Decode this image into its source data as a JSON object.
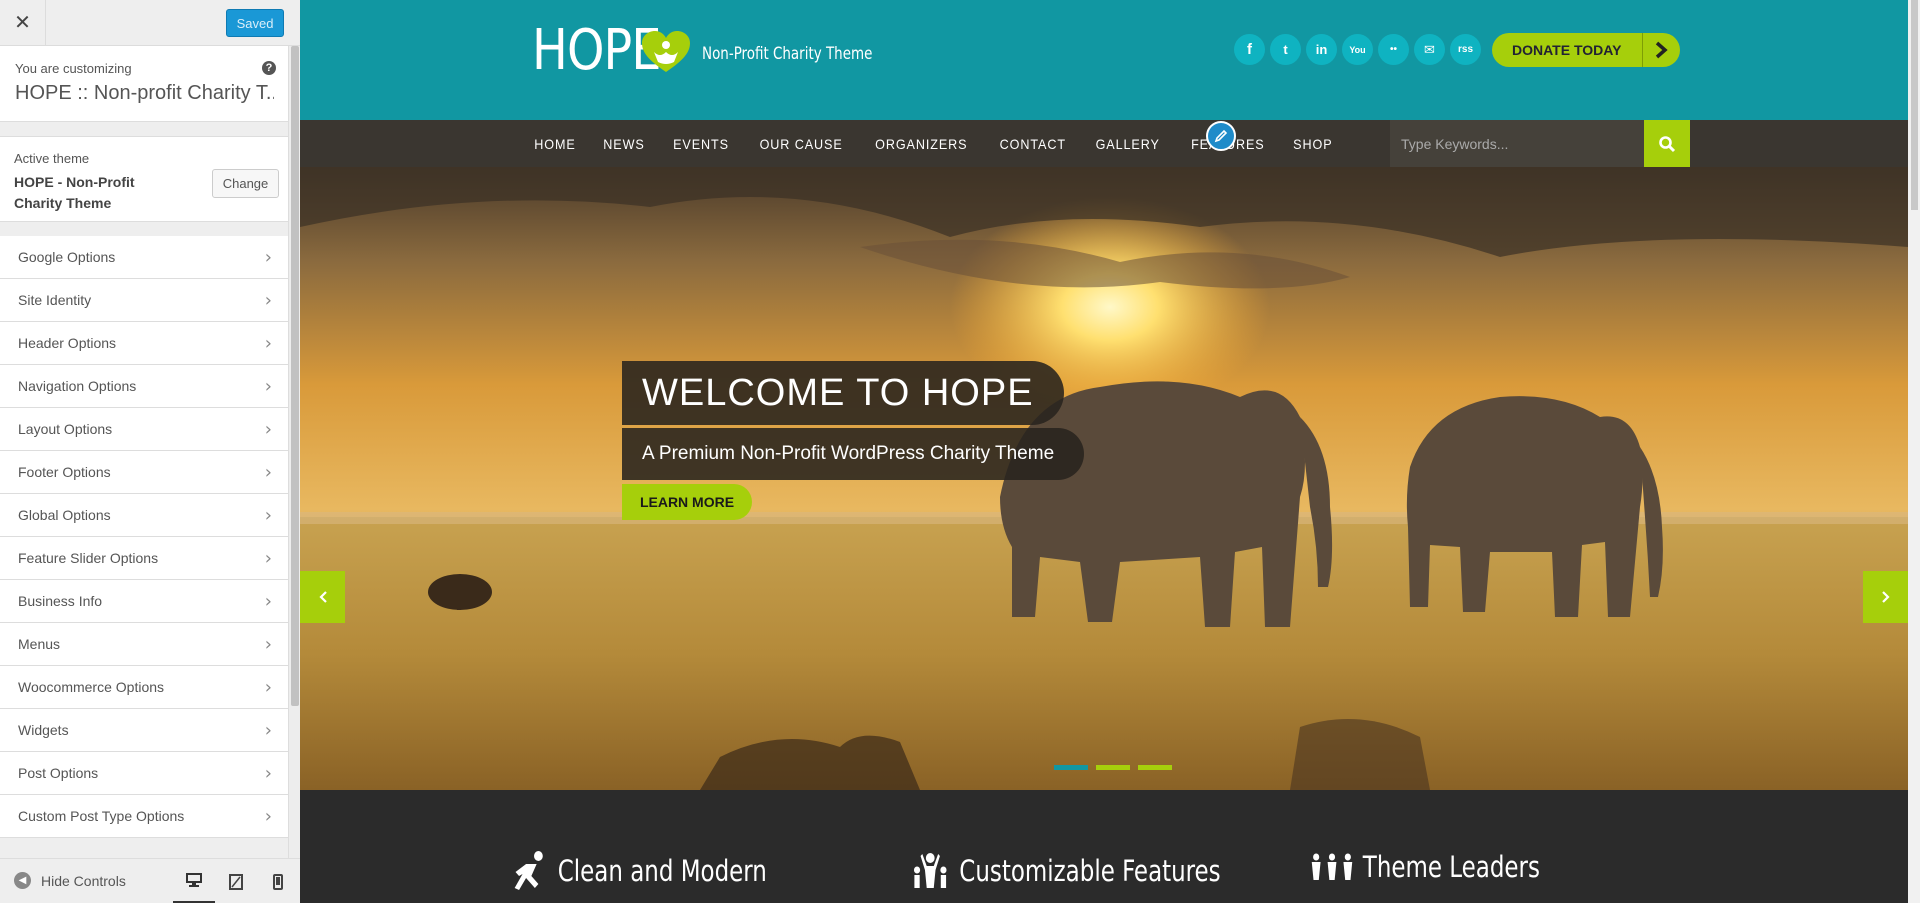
{
  "sidebar": {
    "close_icon": "close-icon",
    "saved_label": "Saved",
    "customizing_label": "You are customizing",
    "customizing_site": "HOPE :: Non-profit Charity T...",
    "help_glyph": "?",
    "active_theme_label": "Active theme",
    "active_theme_name": "HOPE - Non-Profit Charity Theme",
    "change_label": "Change",
    "items": [
      {
        "label": "Google Options"
      },
      {
        "label": "Site Identity"
      },
      {
        "label": "Header Options"
      },
      {
        "label": "Navigation Options"
      },
      {
        "label": "Layout Options"
      },
      {
        "label": "Footer Options"
      },
      {
        "label": "Global Options"
      },
      {
        "label": "Feature Slider Options"
      },
      {
        "label": "Business Info"
      },
      {
        "label": "Menus"
      },
      {
        "label": "Woocommerce Options"
      },
      {
        "label": "Widgets"
      },
      {
        "label": "Post Options"
      },
      {
        "label": "Custom Post Type Options"
      }
    ],
    "hide_controls_label": "Hide Controls",
    "devices": [
      "desktop-icon",
      "tablet-icon",
      "mobile-icon"
    ]
  },
  "site": {
    "logo_text": "HOPE",
    "tagline": "Non-Profit Charity Theme",
    "socials": [
      "f",
      "t",
      "in",
      "You",
      "••",
      "✉",
      "rss"
    ],
    "donate_label": "DONATE TODAY",
    "nav": [
      "HOME",
      "NEWS",
      "EVENTS",
      "OUR CAUSE",
      "ORGANIZERS",
      "CONTACT",
      "GALLERY",
      "FEATURES",
      "SHOP"
    ],
    "search_placeholder": "Type Keywords...",
    "hero_title": "WELCOME TO HOPE",
    "hero_subtitle": "A Premium Non-Profit WordPress Charity Theme",
    "learn_more_label": "LEARN MORE",
    "features": [
      "Clean and Modern",
      "Customizable Features",
      "Theme Leaders"
    ]
  },
  "colors": {
    "header_teal": "#1197a2",
    "accent_green": "#a6cf0b",
    "nav_dark": "#3a3630",
    "saved_blue": "#1a98d6"
  }
}
